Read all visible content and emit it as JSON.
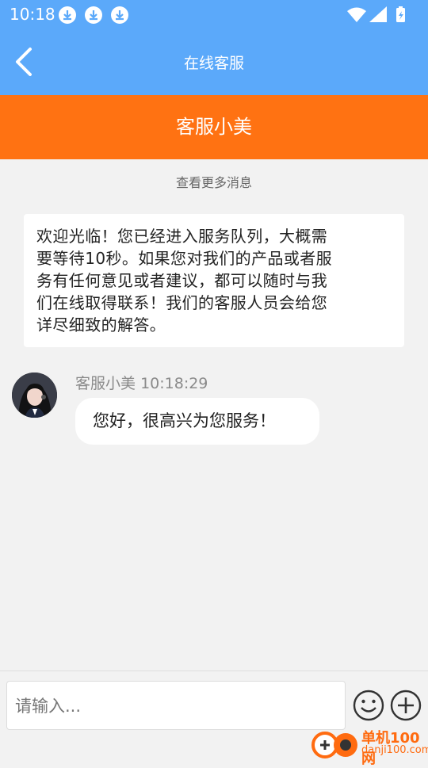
{
  "status": {
    "time": "10:18",
    "icons": [
      "download-icon",
      "download-icon",
      "download-icon"
    ],
    "right_icons": [
      "wifi-icon",
      "signal-icon",
      "battery-icon"
    ]
  },
  "header": {
    "title": "在线客服",
    "back_icon": "back-arrow-icon"
  },
  "agent": {
    "name": "客服小美"
  },
  "chat": {
    "load_more": "查看更多消息",
    "welcome_lines": [
      "欢迎光临！您已经进入服务队列，大概需",
      "要等待10秒。如果您对我们的产品或者服",
      "务有任何意见或者建议，都可以随时与我",
      "们在线取得联系！我们的客服人员会给您",
      "详尽细致的解答。"
    ],
    "message": {
      "sender": "客服小美",
      "time": "10:18:29",
      "text": "您好，很高兴为您服务！"
    }
  },
  "input": {
    "placeholder": "请输入..."
  },
  "watermark": {
    "title": "单机100网",
    "url": "danji100.com"
  },
  "colors": {
    "header": "#5ba9fa",
    "agent_bar": "#ff7212",
    "background": "#f2f2f2"
  }
}
